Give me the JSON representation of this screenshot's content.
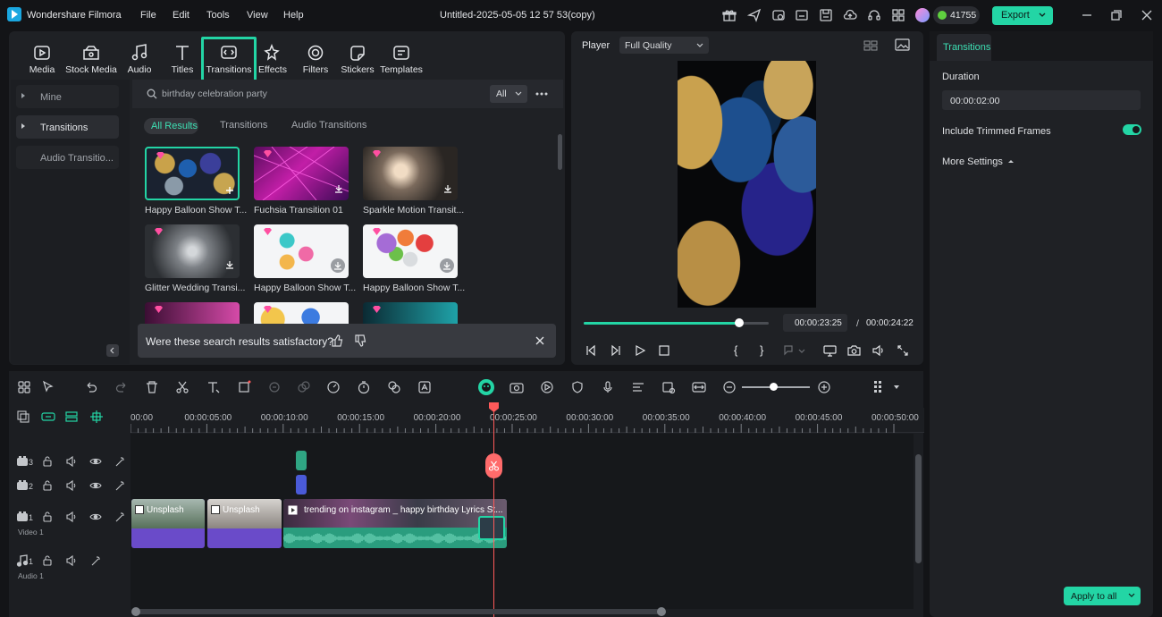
{
  "app": {
    "name": "Wondershare Filmora",
    "doc_title": "Untitled-2025-05-05 12 57 53(copy)",
    "credits": "41755",
    "export_label": "Export"
  },
  "menu": [
    "File",
    "Edit",
    "Tools",
    "View",
    "Help"
  ],
  "toolbar": [
    {
      "label": "Media",
      "icon": "media-icon"
    },
    {
      "label": "Stock Media",
      "icon": "stock-media-icon"
    },
    {
      "label": "Audio",
      "icon": "audio-icon"
    },
    {
      "label": "Titles",
      "icon": "titles-icon"
    },
    {
      "label": "Transitions",
      "icon": "transitions-icon",
      "active": true
    },
    {
      "label": "Effects",
      "icon": "effects-icon"
    },
    {
      "label": "Filters",
      "icon": "filters-icon"
    },
    {
      "label": "Stickers",
      "icon": "stickers-icon"
    },
    {
      "label": "Templates",
      "icon": "templates-icon"
    }
  ],
  "sidebar": {
    "items": [
      {
        "label": "Mine"
      },
      {
        "label": "Transitions"
      },
      {
        "label": "Audio Transitio..."
      }
    ]
  },
  "search": {
    "value": "birthday celebration party",
    "filter": "All"
  },
  "result_tabs": [
    {
      "label": "All Results",
      "active": true
    },
    {
      "label": "Transitions"
    },
    {
      "label": "Audio Transitions"
    }
  ],
  "results": [
    {
      "caption": "Happy Balloon Show T...",
      "selected": true
    },
    {
      "caption": "Fuchsia Transition 01"
    },
    {
      "caption": "Sparkle Motion Transit..."
    },
    {
      "caption": "Glitter Wedding Transi..."
    },
    {
      "caption": "Happy Balloon Show T..."
    },
    {
      "caption": "Happy Balloon Show T..."
    }
  ],
  "feedback": {
    "question": "Were these search results satisfactory?"
  },
  "player": {
    "label": "Player",
    "quality": "Full Quality",
    "current_time": "00:00:23:25",
    "separator": "/",
    "total_time": "00:00:24:22",
    "progress": 0.84
  },
  "properties": {
    "tab": "Transitions",
    "duration_label": "Duration",
    "duration_value": "00:00:02:00",
    "include_trimmed_label": "Include Trimmed Frames",
    "include_trimmed_on": true,
    "more_settings": "More Settings",
    "apply_all": "Apply to all"
  },
  "timeline": {
    "ruler": [
      "00:00",
      "00:00:05:00",
      "00:00:10:00",
      "00:00:15:00",
      "00:00:20:00",
      "00:00:25:00",
      "00:00:30:00",
      "00:00:35:00",
      "00:00:40:00",
      "00:00:45:00",
      "00:00:50:00"
    ],
    "tracks": [
      {
        "num": "3"
      },
      {
        "num": "2"
      },
      {
        "num": "1",
        "name": "Video 1"
      },
      {
        "num": "1",
        "name": "Audio 1"
      }
    ],
    "clips": [
      {
        "label": "Unsplash"
      },
      {
        "label": "Unsplash"
      },
      {
        "label": "trending on instagram _ happy birthday Lyrics St..."
      }
    ]
  },
  "colors": {
    "accent": "#23d5a5",
    "playhead": "#ff5a5a",
    "clip_purple": "#6a4bc9",
    "audio_green": "#2a9d7e"
  }
}
